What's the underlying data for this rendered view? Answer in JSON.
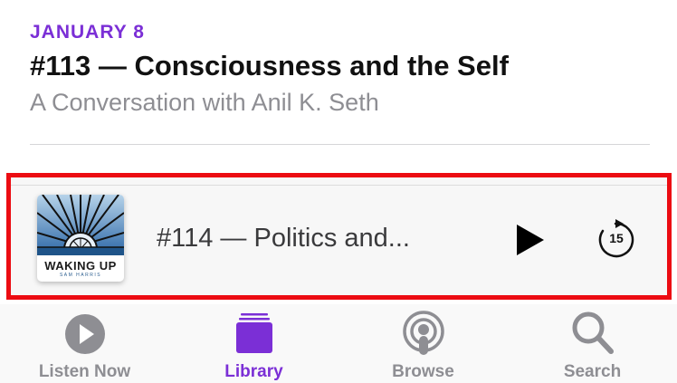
{
  "episode": {
    "date": "JANUARY 8",
    "title": "#113 — Consciousness and the Self",
    "subtitle": "A Conversation with Anil K. Seth"
  },
  "mini_player": {
    "artwork": {
      "brand": "WAKING UP",
      "subbrand": "SAM HARRIS"
    },
    "title": "#114 — Politics and...",
    "skip_seconds": "15"
  },
  "tabs": [
    {
      "label": "Listen Now",
      "icon": "play-circle-icon",
      "active": false
    },
    {
      "label": "Library",
      "icon": "library-icon",
      "active": true
    },
    {
      "label": "Browse",
      "icon": "podcasts-icon",
      "active": false
    },
    {
      "label": "Search",
      "icon": "magnifier-icon",
      "active": false
    }
  ],
  "colors": {
    "accent": "#7b2fd6",
    "highlight_border": "#ec0c12",
    "inactive": "#8e8e93"
  }
}
